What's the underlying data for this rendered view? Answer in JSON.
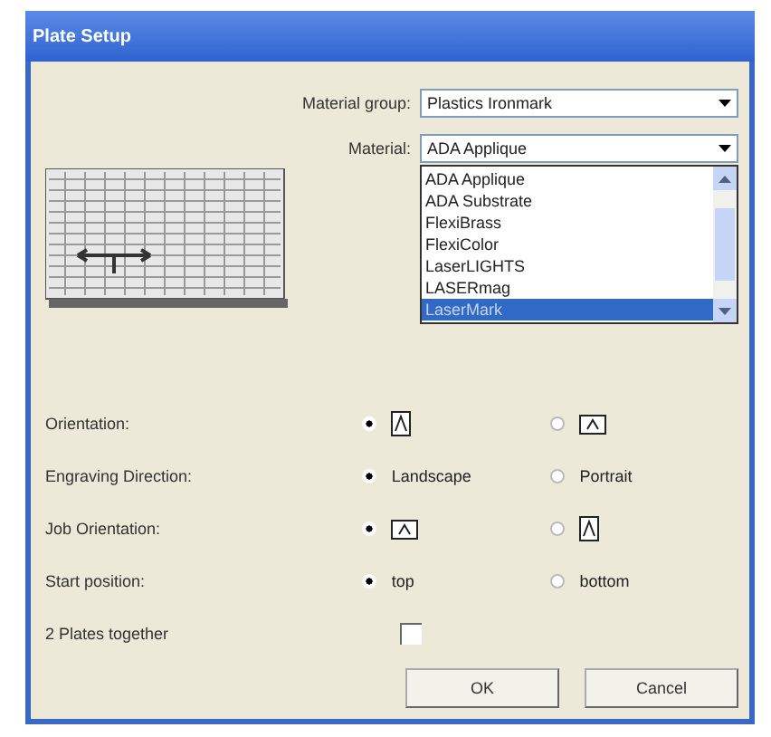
{
  "window": {
    "title": "Plate Setup"
  },
  "material_group": {
    "label": "Material group:",
    "value": "Plastics Ironmark"
  },
  "material": {
    "label": "Material:",
    "value": "ADA Applique"
  },
  "material_list": [
    {
      "label": "ADA Applique",
      "selected": false
    },
    {
      "label": "ADA Substrate",
      "selected": false
    },
    {
      "label": "FlexiBrass",
      "selected": false
    },
    {
      "label": "FlexiColor",
      "selected": false
    },
    {
      "label": "LaserLIGHTS",
      "selected": false
    },
    {
      "label": "LASERmag",
      "selected": false
    },
    {
      "label": "LaserMark",
      "selected": true
    }
  ],
  "settings": [
    {
      "label": "Orientation:",
      "kind": "radio",
      "options": [
        {
          "kind": "portrait",
          "selected": true
        },
        {
          "kind": "landscape",
          "selected": false
        }
      ]
    },
    {
      "label": "Engraving Direction:",
      "kind": "radio",
      "options": [
        {
          "kind": "text",
          "label": "Landscape",
          "selected": true
        },
        {
          "kind": "text",
          "label": "Portrait",
          "selected": false
        }
      ]
    },
    {
      "label": "Job Orientation:",
      "kind": "radio",
      "options": [
        {
          "kind": "landscape",
          "selected": true
        },
        {
          "kind": "portrait",
          "selected": false
        }
      ]
    },
    {
      "label": "Start position:",
      "kind": "radio",
      "options": [
        {
          "kind": "text",
          "label": "top",
          "selected": true
        },
        {
          "kind": "text",
          "label": "bottom",
          "selected": false
        }
      ]
    },
    {
      "label": "2 Plates together",
      "kind": "checkbox",
      "checked": false
    }
  ],
  "buttons": [
    "OK",
    "Cancel"
  ]
}
